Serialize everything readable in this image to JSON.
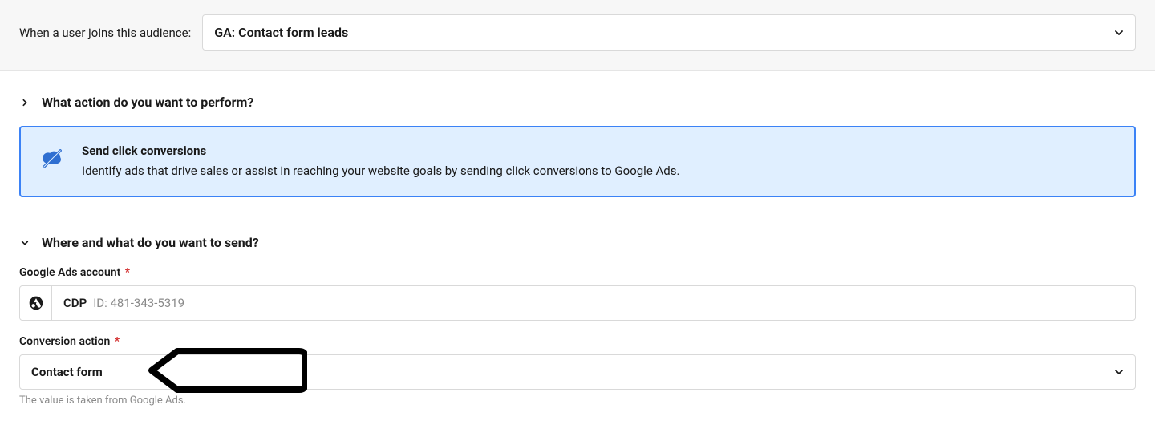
{
  "top": {
    "label": "When a user joins this audience:",
    "select_value": "GA: Contact form leads"
  },
  "section_action": {
    "heading": "What action do you want to perform?",
    "card_title": "Send click conversions",
    "card_desc": "Identify ads that drive sales or assist in reaching your website goals by sending click conversions to Google Ads."
  },
  "section_send": {
    "heading": "Where and what do you want to send?",
    "account_label": "Google Ads account",
    "account_name": "CDP",
    "account_id": "ID: 481-343-5319",
    "conversion_label": "Conversion action",
    "conversion_value": "Contact form",
    "conversion_helper": "The value is taken from Google Ads.",
    "required_mark": "*"
  }
}
